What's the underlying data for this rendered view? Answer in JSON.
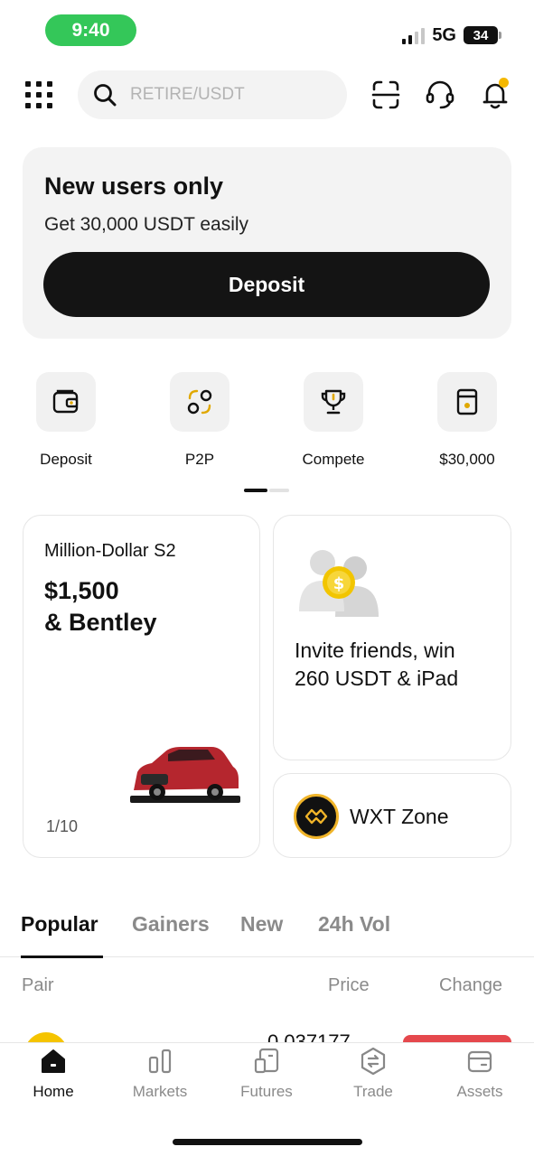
{
  "status_bar": {
    "time": "9:40",
    "network": "5G",
    "battery": "34"
  },
  "header": {
    "search_placeholder": "RETIRE/USDT"
  },
  "promo": {
    "title": "New users only",
    "subtitle": "Get 30,000 USDT easily",
    "button_label": "Deposit"
  },
  "quick_actions": [
    {
      "label": "Deposit",
      "icon": "wallet-icon"
    },
    {
      "label": "P2P",
      "icon": "p2p-icon"
    },
    {
      "label": "Compete",
      "icon": "trophy-icon"
    },
    {
      "label": "$30,000",
      "icon": "gift-box-icon"
    }
  ],
  "pager": {
    "active_index": 0,
    "count": 2
  },
  "cards": {
    "promo_left": {
      "title": "Million-Dollar S2",
      "amount_line1": "$1,500",
      "amount_line2": "& Bentley",
      "page": "1/10"
    },
    "invite": {
      "line1": "Invite friends, win",
      "line2": "260 USDT & iPad"
    },
    "wxt": {
      "label": "WXT Zone"
    }
  },
  "tabs": [
    "Popular",
    "Gainers",
    "New",
    "24h Vol"
  ],
  "active_tab": "Popular",
  "columns": {
    "pair": "Pair",
    "price": "Price",
    "change": "Change"
  },
  "first_row": {
    "price": "0.037177"
  },
  "bottom_nav": [
    {
      "label": "Home",
      "icon": "home-icon"
    },
    {
      "label": "Markets",
      "icon": "markets-icon"
    },
    {
      "label": "Futures",
      "icon": "futures-icon"
    },
    {
      "label": "Trade",
      "icon": "trade-icon"
    },
    {
      "label": "Assets",
      "icon": "assets-icon"
    }
  ],
  "colors": {
    "accent": "#f5b800",
    "status_pill": "#34c759",
    "change_negative": "#e5484d",
    "primary_button": "#141414"
  }
}
